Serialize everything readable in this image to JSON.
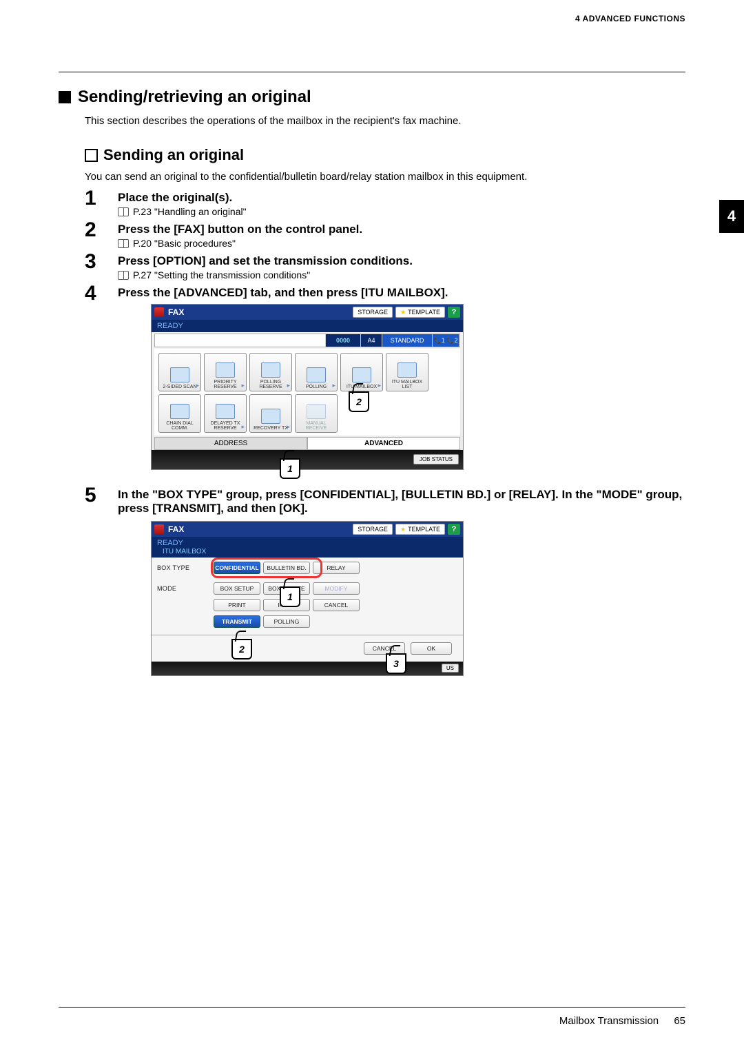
{
  "chapter_header": "4 ADVANCED FUNCTIONS",
  "side_tab": "4",
  "h1": "Sending/retrieving an original",
  "h1_intro": "This section describes the operations of the mailbox in the recipient's fax machine.",
  "h2": "Sending an original",
  "h2_intro": "You can send an original to the confidential/bulletin board/relay station mailbox in this equipment.",
  "steps": [
    {
      "title": "Place the original(s).",
      "ref": "P.23 \"Handling an original\""
    },
    {
      "title": "Press the [FAX] button on the control panel.",
      "ref": "P.20 \"Basic procedures\""
    },
    {
      "title": "Press [OPTION] and set the transmission conditions.",
      "ref": "P.27 \"Setting the transmission conditions\""
    },
    {
      "title": "Press the [ADVANCED] tab, and then press [ITU MAILBOX].",
      "ref": ""
    },
    {
      "title": "In the \"BOX TYPE\" group, press [CONFIDENTIAL], [BULLETIN BD.] or [RELAY]. In the \"MODE\" group, press [TRANSMIT], and then [OK].",
      "ref": ""
    }
  ],
  "screen1": {
    "title": "FAX",
    "storage": "STORAGE",
    "template": "TEMPLATE",
    "help": "?",
    "ready": "READY",
    "counter": "0000",
    "paper": "A4",
    "standard": "STANDARD",
    "phones": "📞1 📞2",
    "cells_row1": [
      "2-SIDED SCAN",
      "PRIORITY RESERVE",
      "POLLING RESERVE",
      "POLLING",
      "ITU MAILBOX",
      "ITU MAILBOX LIST"
    ],
    "cells_row2": [
      "CHAIN DIAL COMM.",
      "DELAYED TX RESERVE",
      "RECOVERY TX",
      "MANUAL RECEIVE"
    ],
    "tab_address": "ADDRESS",
    "tab_advanced": "ADVANCED",
    "job_status": "JOB STATUS",
    "callouts": {
      "c1": "1",
      "c2": "2"
    }
  },
  "screen2": {
    "title": "FAX",
    "storage": "STORAGE",
    "template": "TEMPLATE",
    "help": "?",
    "ready": "READY",
    "sub": "ITU MAILBOX",
    "label_boxtype": "BOX TYPE",
    "label_mode": "MODE",
    "boxtype_buttons": [
      "CONFIDENTIAL",
      "BULLETIN BD.",
      "RELAY"
    ],
    "mode_row1": [
      "BOX SETUP",
      "BOX DELETE",
      "MODIFY"
    ],
    "mode_row2": [
      "PRINT",
      "INPUT",
      "CANCEL"
    ],
    "mode_row3": [
      "TRANSMIT",
      "POLLING"
    ],
    "cancel": "CANCEL",
    "ok": "OK",
    "us": "US",
    "callouts": {
      "c1": "1",
      "c2": "2",
      "c3": "3"
    }
  },
  "footer": {
    "section": "Mailbox Transmission",
    "page": "65"
  }
}
